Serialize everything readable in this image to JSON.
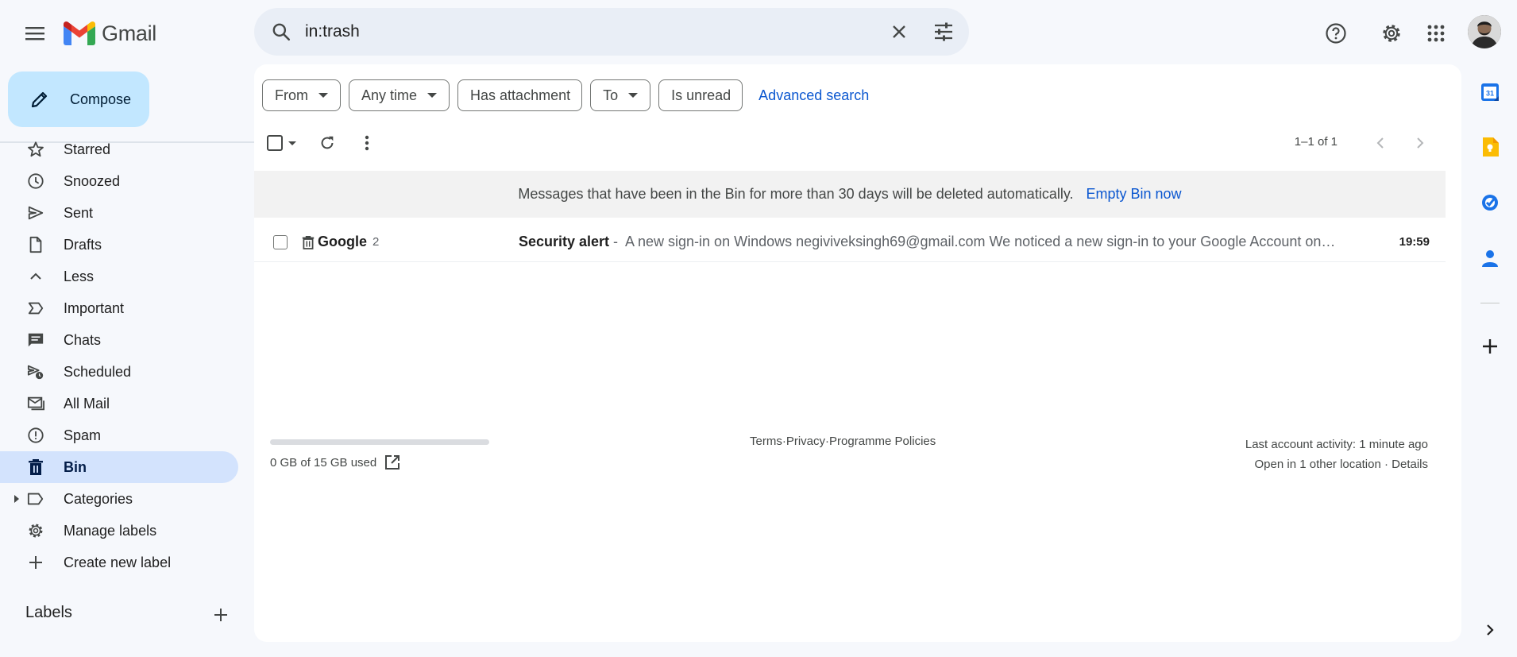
{
  "header": {
    "app_name": "Gmail",
    "search_value": "in:trash"
  },
  "sidebar": {
    "compose_label": "Compose",
    "items": [
      {
        "label": "Starred",
        "icon": "star-icon"
      },
      {
        "label": "Snoozed",
        "icon": "clock-icon"
      },
      {
        "label": "Sent",
        "icon": "send-icon"
      },
      {
        "label": "Drafts",
        "icon": "draft-icon"
      },
      {
        "label": "Less",
        "icon": "chevron-up-icon"
      },
      {
        "label": "Important",
        "icon": "important-icon"
      },
      {
        "label": "Chats",
        "icon": "chat-icon"
      },
      {
        "label": "Scheduled",
        "icon": "scheduled-icon"
      },
      {
        "label": "All Mail",
        "icon": "all-mail-icon"
      },
      {
        "label": "Spam",
        "icon": "spam-icon"
      },
      {
        "label": "Bin",
        "icon": "trash-icon",
        "active": true
      },
      {
        "label": "Categories",
        "icon": "label-icon"
      },
      {
        "label": "Manage labels",
        "icon": "gear-icon"
      },
      {
        "label": "Create new label",
        "icon": "plus-icon"
      }
    ],
    "labels_heading": "Labels"
  },
  "filters": {
    "chips": [
      "From",
      "Any time",
      "Has attachment",
      "To",
      "Is unread"
    ],
    "advanced_search": "Advanced search"
  },
  "toolbar": {
    "pagination": "1–1 of 1"
  },
  "bin_banner": {
    "message": "Messages that have been in the Bin for more than 30 days will be deleted automatically.",
    "action": "Empty Bin now"
  },
  "messages": [
    {
      "sender": "Google",
      "count": "2",
      "subject": "Security alert",
      "separator": "-",
      "snippet": "A new sign-in on Windows negiviveksingh69@gmail.com We noticed a new sign-in to your Google Account on a Windows device. If this was you, you don't need to do anything.",
      "time": "19:59"
    }
  ],
  "footer": {
    "storage_used_fraction": 0.0,
    "storage_text": "0 GB of 15 GB used",
    "links": [
      "Terms",
      "Privacy",
      "Programme Policies"
    ],
    "link_separator": " · ",
    "last_activity": "Last account activity: 1 minute ago",
    "open_location": "Open in 1 other location",
    "details": "Details"
  },
  "colors": {
    "accent": "#0b57d0",
    "compose_bg": "#c2e7ff",
    "active_nav": "#d3e3fd",
    "background": "#f6f8fc"
  }
}
